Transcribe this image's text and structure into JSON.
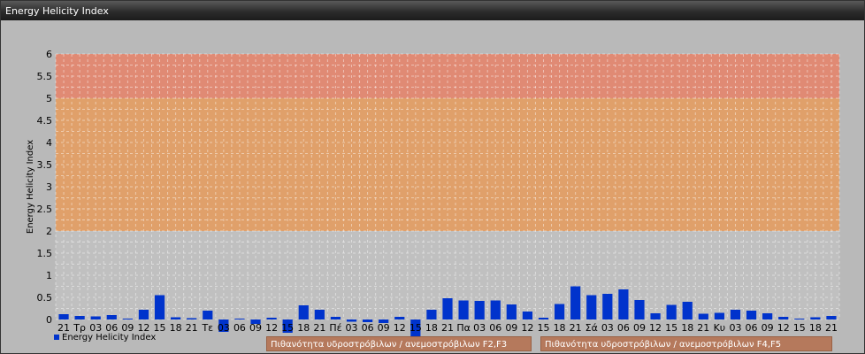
{
  "window": {
    "title": "Energy Helicity Index"
  },
  "legend_items": [
    {
      "label": "Energy Helicity Index",
      "color": "#0033cc"
    },
    {
      "label": "Πιθανότητα υδροστρόβιλων / ανεμοστρόβιλων F2,F3",
      "color": "#b5795c"
    },
    {
      "label": "Πιθανότητα υδροστρόβιλων / ανεμοστρόβιλων F4,F5",
      "color": "#b5795c"
    }
  ],
  "chart_data": {
    "type": "bar",
    "title": "",
    "ylabel": "Energy Helicity Index",
    "xlabel": "",
    "ylim": [
      0,
      6
    ],
    "yticks": [
      0,
      0.5,
      1,
      1.5,
      2,
      2.5,
      3,
      3.5,
      4,
      4.5,
      5,
      5.5,
      6
    ],
    "grid": true,
    "legend_position": "bottom-left",
    "bands": [
      {
        "from": 0,
        "to": 2,
        "color": "#c0c0c0"
      },
      {
        "from": 2,
        "to": 5,
        "color": "#e0a06a"
      },
      {
        "from": 5,
        "to": 6,
        "color": "#e08a74"
      }
    ],
    "categories": [
      "21",
      "Τρ",
      "03",
      "06",
      "09",
      "12",
      "15",
      "18",
      "21",
      "Τε",
      "03",
      "06",
      "09",
      "12",
      "15",
      "18",
      "21",
      "Πέ",
      "03",
      "06",
      "09",
      "12",
      "15",
      "18",
      "21",
      "Πα",
      "03",
      "06",
      "09",
      "12",
      "15",
      "18",
      "21",
      "Σά",
      "03",
      "06",
      "09",
      "12",
      "15",
      "18",
      "21",
      "Κυ",
      "03",
      "06",
      "09",
      "12",
      "15",
      "18",
      "21"
    ],
    "series": [
      {
        "name": "Energy Helicity Index",
        "color": "#0033cc",
        "values": [
          0.12,
          0.08,
          0.07,
          0.1,
          0.02,
          0.22,
          0.55,
          0.05,
          0.03,
          0.2,
          -0.28,
          0.02,
          -0.1,
          0.04,
          -0.3,
          0.32,
          0.22,
          0.06,
          -0.05,
          -0.06,
          -0.08,
          0.06,
          -0.42,
          0.22,
          0.48,
          0.43,
          0.42,
          0.43,
          0.34,
          0.18,
          0.04,
          0.35,
          0.75,
          0.55,
          0.58,
          0.68,
          0.44,
          0.14,
          0.33,
          0.4,
          0.13,
          0.15,
          0.22,
          0.2,
          0.14,
          0.06,
          0.02,
          0.05,
          0.08
        ]
      }
    ]
  }
}
